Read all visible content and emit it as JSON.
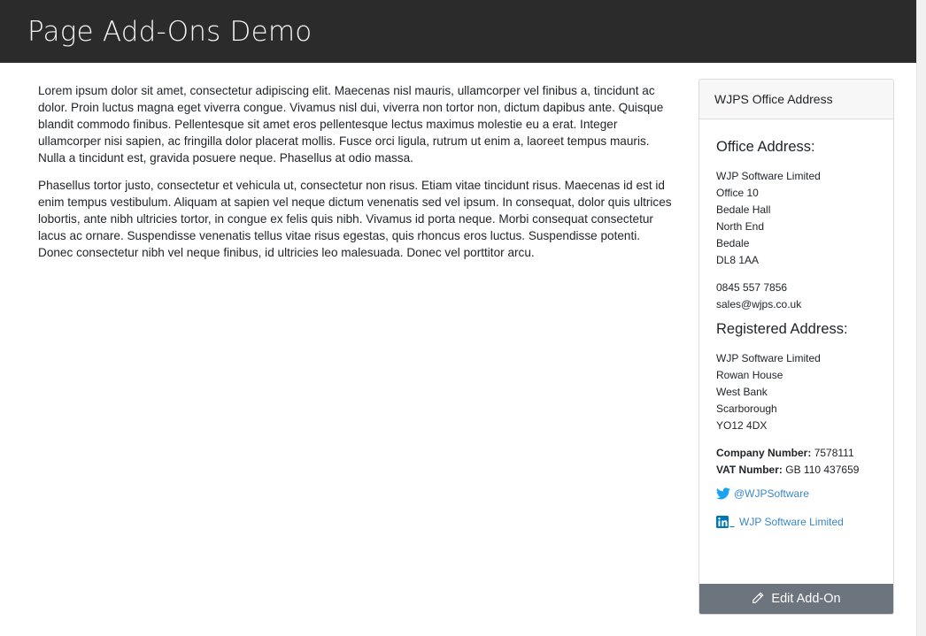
{
  "header": {
    "title": "Page Add-Ons Demo"
  },
  "main": {
    "paragraphs": [
      "Lorem ipsum dolor sit amet, consectetur adipiscing elit. Maecenas nisl mauris, ullamcorper vel finibus a, tincidunt ac dolor. Proin luctus magna eget viverra congue. Vivamus nisl dui, viverra non tortor non, dictum dapibus ante. Quisque blandit commodo finibus. Pellentesque sit amet eros pellentesque lectus maximus molestie eu a erat. Integer ullamcorper nisi sapien, ac fringilla dolor placerat mollis. Fusce orci ligula, rutrum ut enim a, laoreet tempus mauris. Nulla a tincidunt est, gravida posuere neque. Phasellus at odio massa.",
      "Phasellus tortor justo, consectetur et vehicula ut, consectetur non risus. Etiam vitae tincidunt risus. Maecenas id est id enim tempus vestibulum. Aliquam at sapien vel neque dictum venenatis sed vel ipsum. In consequat, dolor quis ultrices lobortis, ante nibh ultricies tortor, in congue ex felis quis nibh. Vivamus id porta neque. Morbi consequat consectetur lacus ac ornare. Suspendisse venenatis tellus vitae risus egestas, quis rhoncus eros luctus. Suspendisse potenti. Donec consectetur nibh vel neque finibus, id ultricies leo malesuada. Donec vel porttitor arcu."
    ]
  },
  "sidebar": {
    "card_title": "WJPS Office Address",
    "office": {
      "heading": "Office Address:",
      "lines": [
        "WJP Software Limited",
        "Office 10",
        "Bedale Hall",
        "North End",
        "Bedale",
        "DL8 1AA"
      ],
      "phone": "0845 557 7856",
      "email": "sales@wjps.co.uk"
    },
    "registered": {
      "heading": "Registered Address:",
      "lines": [
        "WJP Software Limited",
        "Rowan House",
        "West Bank",
        "Scarborough",
        "YO12 4DX"
      ]
    },
    "company_label": "Company Number:",
    "company_value": "7578111",
    "vat_label": "VAT Number:",
    "vat_value": "GB 110 437659",
    "twitter": {
      "icon": "twitter-icon",
      "label": "@WJPSoftware",
      "color": "#1da1f2"
    },
    "linkedin": {
      "icon": "linkedin-icon",
      "label": "WJP Software Limited",
      "color": "#0077b5"
    },
    "footer_button": {
      "icon": "pencil-icon",
      "label": "Edit Add-On"
    }
  }
}
